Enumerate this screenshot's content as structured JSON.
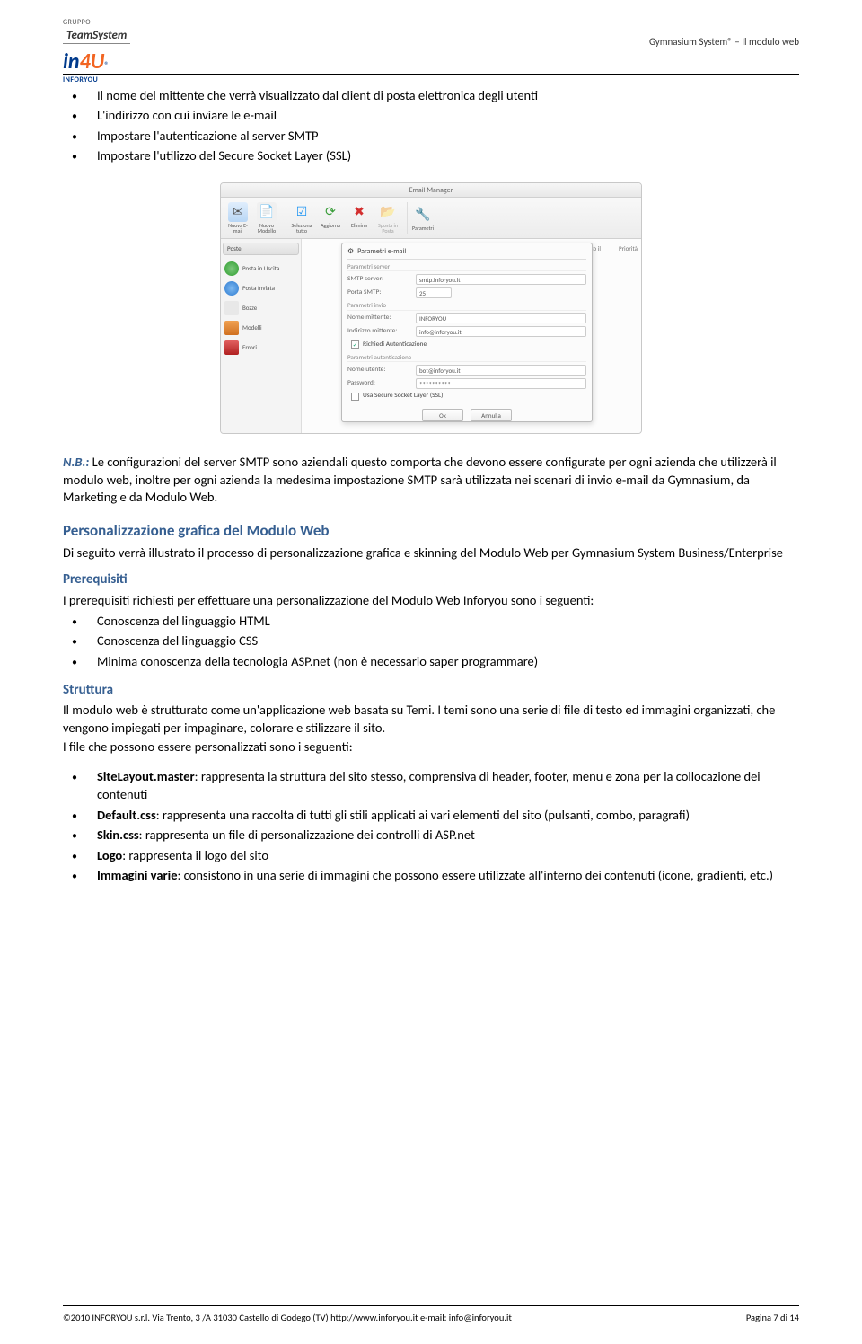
{
  "header": {
    "gruppo": "GRUPPO",
    "team": "TeamSystem",
    "in": "in",
    "fouru": "4U",
    "reg": "®",
    "inforyou": "INFORYOU",
    "rightTitle": "Gymnasium System® – Il modulo web"
  },
  "bullets1": [
    "Il nome del mittente che verrà visualizzato dal client di posta elettronica degli utenti",
    "L'indirizzo con cui inviare le e-mail",
    "Impostare l'autenticazione al server SMTP",
    "Impostare l'utilizzo del Secure Socket Layer (SSL)"
  ],
  "screenshot": {
    "title": "Email Manager",
    "toolbar": {
      "nuovaEmail": "Nuova E-mail",
      "nuovoModello": "Nuovo Modello",
      "selezionaTutto": "Seleziona tutto",
      "aggiorna": "Aggiorna",
      "elimina": "Elimina",
      "spostaIn": "Sposta in Posta",
      "parametri": "Parametri"
    },
    "sidebar": {
      "header": "Poste",
      "items": [
        "Posta in Uscita",
        "Posta Inviata",
        "Bozze",
        "Modelli",
        "Errori"
      ]
    },
    "columns": {
      "inviato": "Inviato il",
      "priorita": "Priorità"
    },
    "dialog": {
      "title": "Parametri e-mail",
      "secServer": "Parametri server",
      "smtpServerLabel": "SMTP server:",
      "smtpServerVal": "smtp.inforyou.it",
      "portaLabel": "Porta SMTP:",
      "portaVal": "25",
      "secInvio": "Parametri invio",
      "nomeMitLabel": "Nome mittente:",
      "nomeMitVal": "INFORYOU",
      "indMitLabel": "Indirizzo mittente:",
      "indMitVal": "info@inforyou.it",
      "richAuth": "Richiedi Autenticazione",
      "secAuth": "Parametri autenticazione",
      "userLabel": "Nome utente:",
      "userVal": "bot@inforyou.it",
      "pwdLabel": "Password:",
      "pwdVal": "**********",
      "ssl": "Usa Secure Socket Layer (SSL)",
      "ok": "Ok",
      "annulla": "Annulla"
    }
  },
  "nbLabel": "N.B.:",
  "nbText": " Le configurazioni del server SMTP sono aziendali questo comporta che devono essere configurate per ogni azienda che utilizzerà il modulo web, inoltre per ogni azienda la medesima impostazione SMTP sarà utilizzata nei scenari di invio e-mail da Gymnasium, da Marketing e da Modulo Web.",
  "hPersonal": "Personalizzazione grafica del Modulo Web",
  "pPersonal": "Di seguito verrà illustrato il processo di personalizzazione grafica e skinning del Modulo Web per Gymnasium System Business/Enterprise",
  "hPrereq": "Prerequisiti",
  "pPrereq": "I prerequisiti richiesti per effettuare una personalizzazione del Modulo Web Inforyou sono i seguenti:",
  "bulletsPrereq": [
    "Conoscenza del linguaggio HTML",
    "Conoscenza del linguaggio CSS",
    "Minima conoscenza della tecnologia ASP.net (non è necessario saper programmare)"
  ],
  "hStrutt": "Struttura",
  "pStrutt1": "Il modulo web è strutturato come un'applicazione web basata su Temi. I temi sono una serie di file di testo ed immagini organizzati, che vengono impiegati per impaginare, colorare e stilizzare il sito.",
  "pStrutt2": "I file che possono essere personalizzati sono i seguenti:",
  "struttItems": [
    {
      "b": "SiteLayout.master",
      "t": ": rappresenta la struttura del sito stesso, comprensiva di header, footer, menu e zona per la collocazione dei contenuti"
    },
    {
      "b": "Default.css",
      "t": ": rappresenta una raccolta di tutti gli stili applicati ai vari elementi del sito (pulsanti, combo, paragrafi)"
    },
    {
      "b": "Skin.css",
      "t": ": rappresenta un file di personalizzazione dei controlli di ASP.net"
    },
    {
      "b": "Logo",
      "t": ": rappresenta il logo del sito"
    },
    {
      "b": "Immagini varie",
      "t": ": consistono in una serie di immagini che possono essere utilizzate all'interno dei contenuti (icone, gradienti, etc.)"
    }
  ],
  "footer": {
    "left": "©2010 INFORYOU s.r.l.   Via Trento, 3 /A 31030 Castello di Godego (TV)  http://www.inforyou.it   e-mail: info@inforyou.it",
    "right": "Pagina 7 di 14"
  }
}
